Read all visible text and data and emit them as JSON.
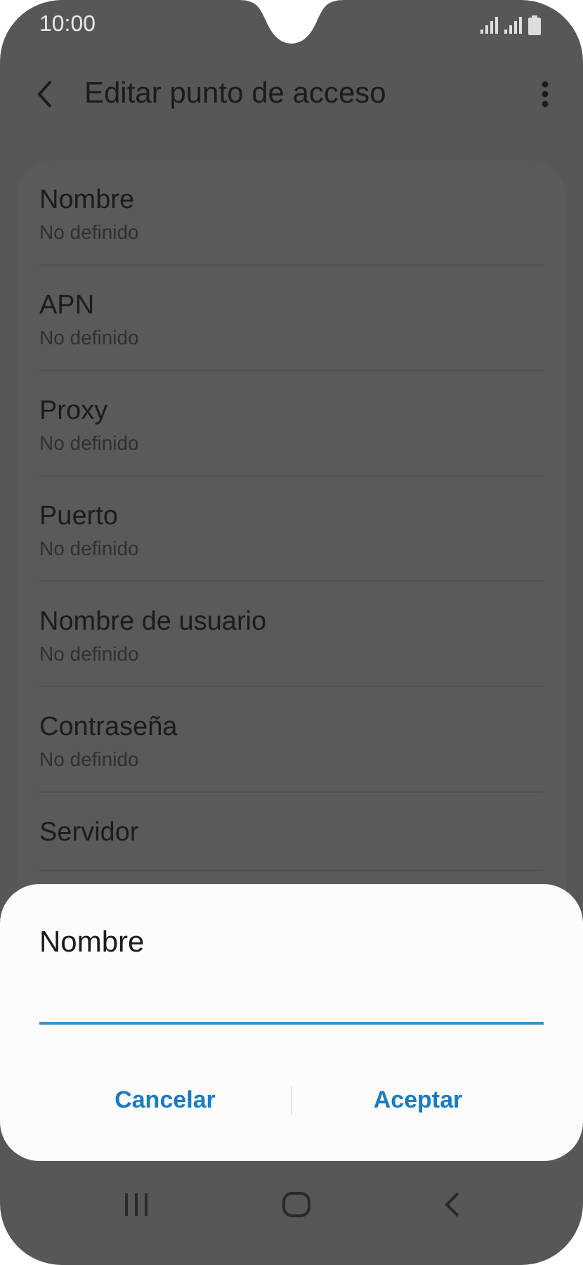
{
  "status_bar": {
    "time": "10:00"
  },
  "header": {
    "title": "Editar punto de acceso"
  },
  "settings": [
    {
      "title": "Nombre",
      "value": "No definido"
    },
    {
      "title": "APN",
      "value": "No definido"
    },
    {
      "title": "Proxy",
      "value": "No definido"
    },
    {
      "title": "Puerto",
      "value": "No definido"
    },
    {
      "title": "Nombre de usuario",
      "value": "No definido"
    },
    {
      "title": "Contraseña",
      "value": "No definido"
    },
    {
      "title": "Servidor"
    }
  ],
  "dialog": {
    "title": "Nombre",
    "buttons": [
      "Cancelar",
      "Aceptar"
    ]
  }
}
